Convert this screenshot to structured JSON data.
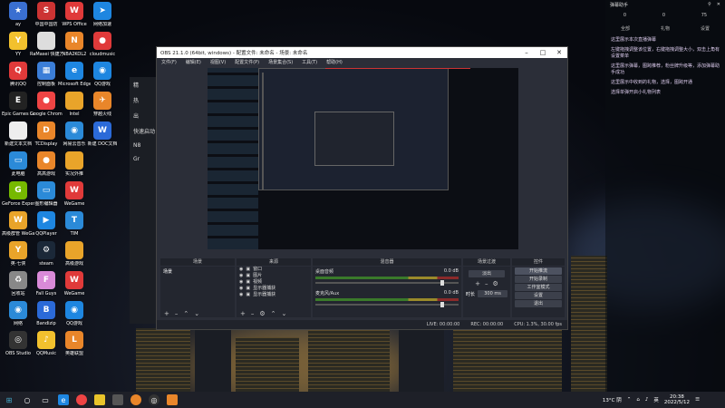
{
  "desktop": {
    "icons": [
      {
        "label": "ay",
        "color": "#3a6fd1",
        "glyph": "★"
      },
      {
        "label": "YY",
        "color": "#f2c12e",
        "glyph": "Y"
      },
      {
        "label": "腾讯QQ",
        "color": "#e03a3a",
        "glyph": "Q"
      },
      {
        "label": "Epic Games Launcher",
        "color": "#222",
        "glyph": "E"
      },
      {
        "label": "新建文本文档",
        "color": "#eee",
        "glyph": ""
      },
      {
        "label": "此电脑",
        "color": "#2b8ad8",
        "glyph": "▭"
      },
      {
        "label": "GeForce Experience",
        "color": "#76b900",
        "glyph": "G"
      },
      {
        "label": "高级群管 WeGame",
        "color": "#e9a42a",
        "glyph": "W"
      },
      {
        "label": "英·七侠",
        "color": "#e9a42a",
        "glyph": "Y"
      },
      {
        "label": "回收站",
        "color": "#888",
        "glyph": "♻"
      },
      {
        "label": "网络",
        "color": "#2b8ad8",
        "glyph": "◉"
      },
      {
        "label": "OBS Studio",
        "color": "#333",
        "glyph": "◎"
      },
      {
        "label": "中国中国防",
        "color": "#c33",
        "glyph": "S"
      },
      {
        "label": "RaMasei 快捷方式",
        "color": "#ddd",
        "glyph": ""
      },
      {
        "label": "控制面板",
        "color": "#3b7ed8",
        "glyph": "▦"
      },
      {
        "label": "Google Chrome",
        "color": "#e44",
        "glyph": "●"
      },
      {
        "label": "TCDisplay",
        "color": "#e9862a",
        "glyph": "D"
      },
      {
        "label": "高高游戏",
        "color": "#e9862a",
        "glyph": "●"
      },
      {
        "label": "图形编辑器",
        "color": "#2b8ad8",
        "glyph": "▭"
      },
      {
        "label": "QQPlayer",
        "color": "#1e86e0",
        "glyph": "▶"
      },
      {
        "label": "steam",
        "color": "#1b2838",
        "glyph": "⚙"
      },
      {
        "label": "Fall Guys",
        "color": "#d98ad8",
        "glyph": "F"
      },
      {
        "label": "Bandizip",
        "color": "#2b6ad8",
        "glyph": "B"
      },
      {
        "label": "QQMusic",
        "color": "#f2c12e",
        "glyph": "♪"
      },
      {
        "label": "WPS Office",
        "color": "#e03a3a",
        "glyph": "W"
      },
      {
        "label": "NBA2KOL2",
        "color": "#e9862a",
        "glyph": "N"
      },
      {
        "label": "Microsoft Edge",
        "color": "#1e86e0",
        "glyph": "e"
      },
      {
        "label": "Intel",
        "color": "#e9a42a",
        "glyph": ""
      },
      {
        "label": "网易云音乐",
        "color": "#2b8ad8",
        "glyph": "◉"
      },
      {
        "label": "实况外推",
        "color": "#e9a42a",
        "glyph": ""
      },
      {
        "label": "WeGame",
        "color": "#e03a3a",
        "glyph": "W"
      },
      {
        "label": "TIM",
        "color": "#2b8ad8",
        "glyph": "T"
      },
      {
        "label": "高级游戏",
        "color": "#e9a42a",
        "glyph": ""
      },
      {
        "label": "WeGame",
        "color": "#e03a3a",
        "glyph": "W"
      },
      {
        "label": "QQ游戏",
        "color": "#1e86e0",
        "glyph": "◉"
      },
      {
        "label": "英雄联盟",
        "color": "#e9862a",
        "glyph": "L"
      },
      {
        "label": "网络加速",
        "color": "#1e86e0",
        "glyph": "➤"
      },
      {
        "label": "cloudmusic",
        "color": "#e03a3a",
        "glyph": "●"
      },
      {
        "label": "QQ游戏",
        "color": "#1e86e0",
        "glyph": "◉"
      },
      {
        "label": "穿越火线",
        "color": "#e9862a",
        "glyph": "✈"
      },
      {
        "label": "新建 DOC文档",
        "color": "#2b6ad8",
        "glyph": "W"
      }
    ]
  },
  "side_panel": {
    "items": [
      "精",
      "热",
      "出",
      "快速启动",
      "N8",
      "Gr"
    ]
  },
  "obs": {
    "title": "OBS 21.1.0 (64bit, windows) - 配置文件: 未命名 - 场景: 未命名",
    "menu": [
      "文件(F)",
      "编辑(E)",
      "视图(V)",
      "配置文件(P)",
      "场景集合(S)",
      "工具(T)",
      "帮助(H)"
    ],
    "docks": {
      "scenes": "场景",
      "sources": "来源",
      "mixer": "混音器",
      "transitions": "场景过渡",
      "controls": "控件"
    },
    "scenes": [
      "场景"
    ],
    "sources": [
      "窗口",
      "图片",
      "视频",
      "显示器捕获",
      "显示器捕获"
    ],
    "mixer_tracks": [
      {
        "name": "桌面音频",
        "value": "0.0 dB"
      },
      {
        "name": "麦克风/Aux",
        "value": "0.0 dB"
      }
    ],
    "transition": {
      "type": "淡出",
      "duration_label": "时长",
      "duration": "300 ms"
    },
    "controls": [
      "开始推流",
      "开始录制",
      "工作室模式",
      "设置",
      "退出"
    ],
    "status": {
      "live": "LIVE: 00:00:00",
      "rec": "REC: 00:00:00",
      "cpu": "CPU: 1.3%, 30.00 fps"
    }
  },
  "notif": {
    "header_left": "弹幕助手",
    "stats": [
      "0",
      "0",
      "75"
    ],
    "tabs": [
      "全部",
      "礼物",
      "设置"
    ],
    "messages": [
      "这里展示本次直播弹幕",
      "左键拖拽调整该位置，右键拖拽调整大小，双击上角有设置菜单",
      "这里展示弹幕，图跨推荐，粉丝牌升级等，添加弹幕助手成功",
      "这里展示中收到的礼物，选择，图跨开通",
      "选择单弹开启小礼物列表"
    ]
  },
  "taskbar": {
    "temp": "13°C 阴",
    "lang": "英",
    "time": "20:38",
    "date": "2022/5/12"
  }
}
